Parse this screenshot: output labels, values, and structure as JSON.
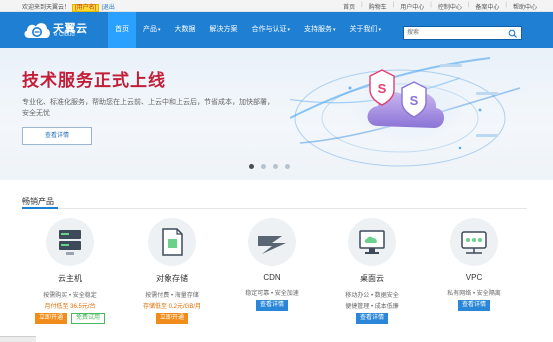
{
  "topbar": {
    "welcome": "欢迎来到天翼云！",
    "username": "[用户名]",
    "separator": "|",
    "logout": "退出",
    "links": [
      "首页",
      "购物车",
      "用户中心",
      "控制中心",
      "备案中心",
      "帮助中心"
    ]
  },
  "nav": {
    "brand": "天翼云",
    "brand_sub": "e Cloud",
    "items": [
      {
        "label": "首页",
        "dropdown": false,
        "active": true
      },
      {
        "label": "产品",
        "dropdown": true,
        "active": false
      },
      {
        "label": "大数据",
        "dropdown": false,
        "active": false
      },
      {
        "label": "解决方案",
        "dropdown": false,
        "active": false
      },
      {
        "label": "合作与认证",
        "dropdown": true,
        "active": false
      },
      {
        "label": "支持服务",
        "dropdown": true,
        "active": false
      },
      {
        "label": "关于我们",
        "dropdown": true,
        "active": false
      }
    ],
    "search_placeholder": "搜索"
  },
  "banner": {
    "headline": "技术服务正式上线",
    "description": "专业化、标准化服务，帮助您在上云前、上云中和上云后，节省成本，加快部署，安全无忧",
    "cta": "查看详情",
    "active_slide": 1,
    "slide_count": 4
  },
  "products": {
    "section_title": "畅销产品",
    "items": [
      {
        "name": "云主机",
        "features": "按需购买 • 安全稳定",
        "price": "月付低至 36.5元/台",
        "buttons": [
          {
            "label": "立即开通",
            "style": "orange"
          },
          {
            "label": "免费试用",
            "style": "green"
          }
        ]
      },
      {
        "name": "对象存储",
        "features": "按需付费 • 海量存储",
        "price": "存储低至 0.2元/GB/月",
        "buttons": [
          {
            "label": "立即开通",
            "style": "orange"
          }
        ]
      },
      {
        "name": "CDN",
        "features": "稳定可靠 • 安全加速",
        "price": "",
        "buttons": [
          {
            "label": "查看详情",
            "style": "blue"
          }
        ]
      },
      {
        "name": "桌面云",
        "features": "移动办公 • 数据安全",
        "price": "便捷管理 • 成本低廉",
        "buttons": [
          {
            "label": "查看详情",
            "style": "blue"
          }
        ]
      },
      {
        "name": "VPC",
        "features": "私有网络 • 安全隔离",
        "price": "",
        "buttons": [
          {
            "label": "查看详情",
            "style": "blue"
          }
        ]
      }
    ]
  },
  "colors": {
    "nav_bg": "#1e7fd3",
    "nav_active": "#2aa0ff",
    "headline": "#c21e37",
    "orange_button": "#f08c1a",
    "blue_button": "#2a86d8"
  }
}
